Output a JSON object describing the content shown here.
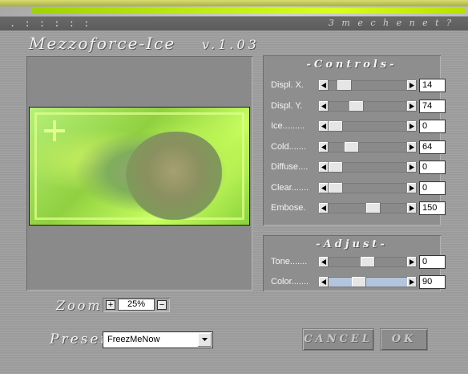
{
  "header": {
    "dots": ". : : : : :",
    "brand": "3 m e c h e n e t ?",
    "title": "Mezzoforce-Ice",
    "version": "v.1.03"
  },
  "controls": {
    "title": "-Controls-",
    "sliders": [
      {
        "label": "Displ. X.",
        "value": "14",
        "level": 0.14
      },
      {
        "label": "Displ. Y.",
        "value": "74",
        "level": 0.33
      },
      {
        "label": "Ice.........",
        "value": "0",
        "level": 0.0
      },
      {
        "label": "Cold.......",
        "value": "64",
        "level": 0.25
      },
      {
        "label": "Diffuse....",
        "value": "0",
        "level": 0.0
      },
      {
        "label": "Clear.......",
        "value": "0",
        "level": 0.0
      },
      {
        "label": "Embose.",
        "value": "150",
        "level": 0.59
      }
    ]
  },
  "adjust": {
    "title": "-Adjust-",
    "sliders": [
      {
        "label": "Tone.......",
        "value": "0",
        "level": 0.5
      },
      {
        "label": "Color.......",
        "value": "90",
        "level": 0.36
      }
    ]
  },
  "zoom": {
    "label": "Zoom",
    "value": "25%",
    "plus": "+",
    "minus": "−"
  },
  "preset": {
    "label": "Preset",
    "selected": "FreezMeNow"
  },
  "buttons": {
    "cancel": "CANCEL",
    "ok": "OK"
  }
}
